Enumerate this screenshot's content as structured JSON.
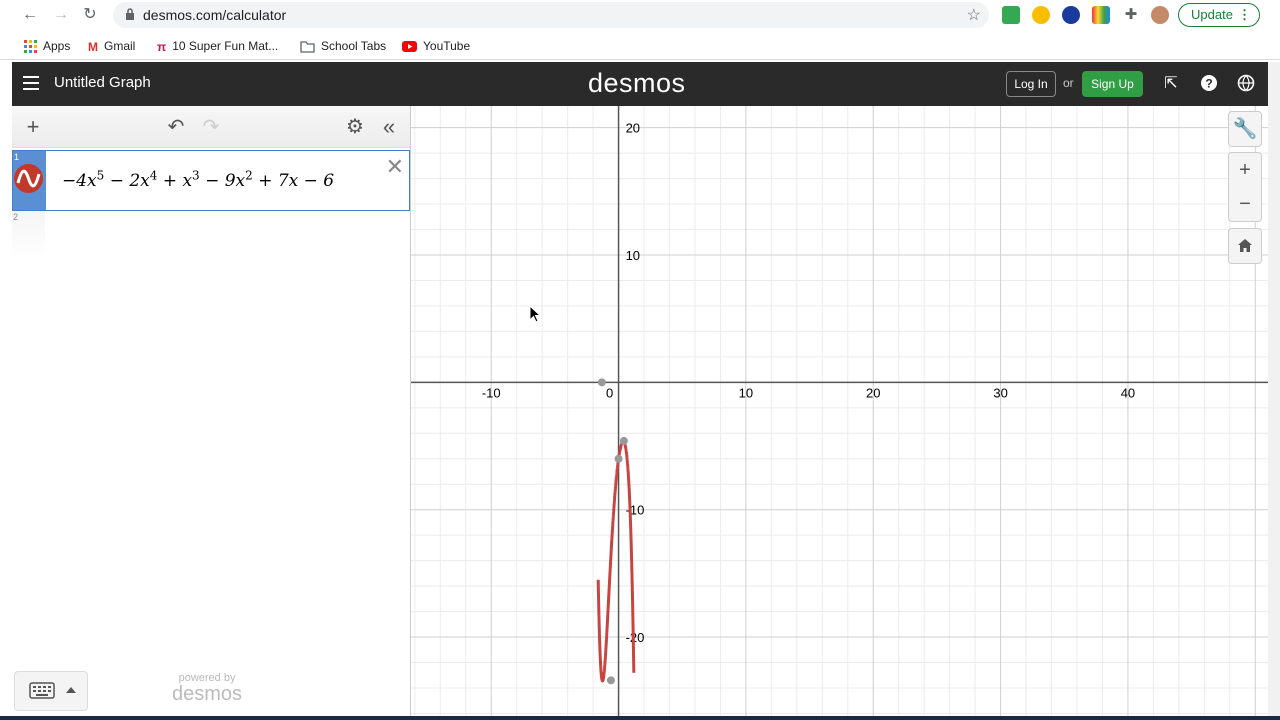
{
  "browser": {
    "url": "desmos.com/calculator",
    "update_label": "Update",
    "bookmarks": [
      {
        "label": "Apps"
      },
      {
        "label": "Gmail"
      },
      {
        "label": "10 Super Fun Mat..."
      },
      {
        "label": "School Tabs"
      },
      {
        "label": "YouTube"
      }
    ]
  },
  "header": {
    "graph_title": "Untitled Graph",
    "logo": "desmos",
    "login_label": "Log In",
    "or_label": "or",
    "signup_label": "Sign Up"
  },
  "expressions": {
    "items": [
      {
        "number": "1",
        "latex": "−4x^5 − 2x^4 + x^3 − 9x^2 + 7x − 6"
      },
      {
        "number": "2",
        "latex": ""
      }
    ],
    "powered_by": "powered by",
    "powered_logo": "desmos"
  },
  "graph": {
    "curve_color": "#c74440",
    "x_ticks": [
      "-10",
      "0",
      "10",
      "20",
      "30",
      "40"
    ],
    "y_ticks": [
      "20",
      "10",
      "-10",
      "-20"
    ]
  },
  "chart_data": {
    "type": "line",
    "function": "-4x^5 - 2x^4 + x^3 - 9x^2 + 7x - 6",
    "xlim": [
      -16.3,
      51
    ],
    "ylim": [
      -26.2,
      21.7
    ],
    "grid": true,
    "x_tick_values": [
      -10,
      0,
      10,
      20,
      30,
      40
    ],
    "y_tick_values": [
      20,
      10,
      -10,
      -20
    ],
    "points_of_interest": [
      {
        "x": -1.31,
        "y": 0
      },
      {
        "x": -0.6,
        "y": -23.4
      },
      {
        "x": 0.42,
        "y": -4.6
      },
      {
        "x": 0,
        "y": -6
      }
    ]
  }
}
